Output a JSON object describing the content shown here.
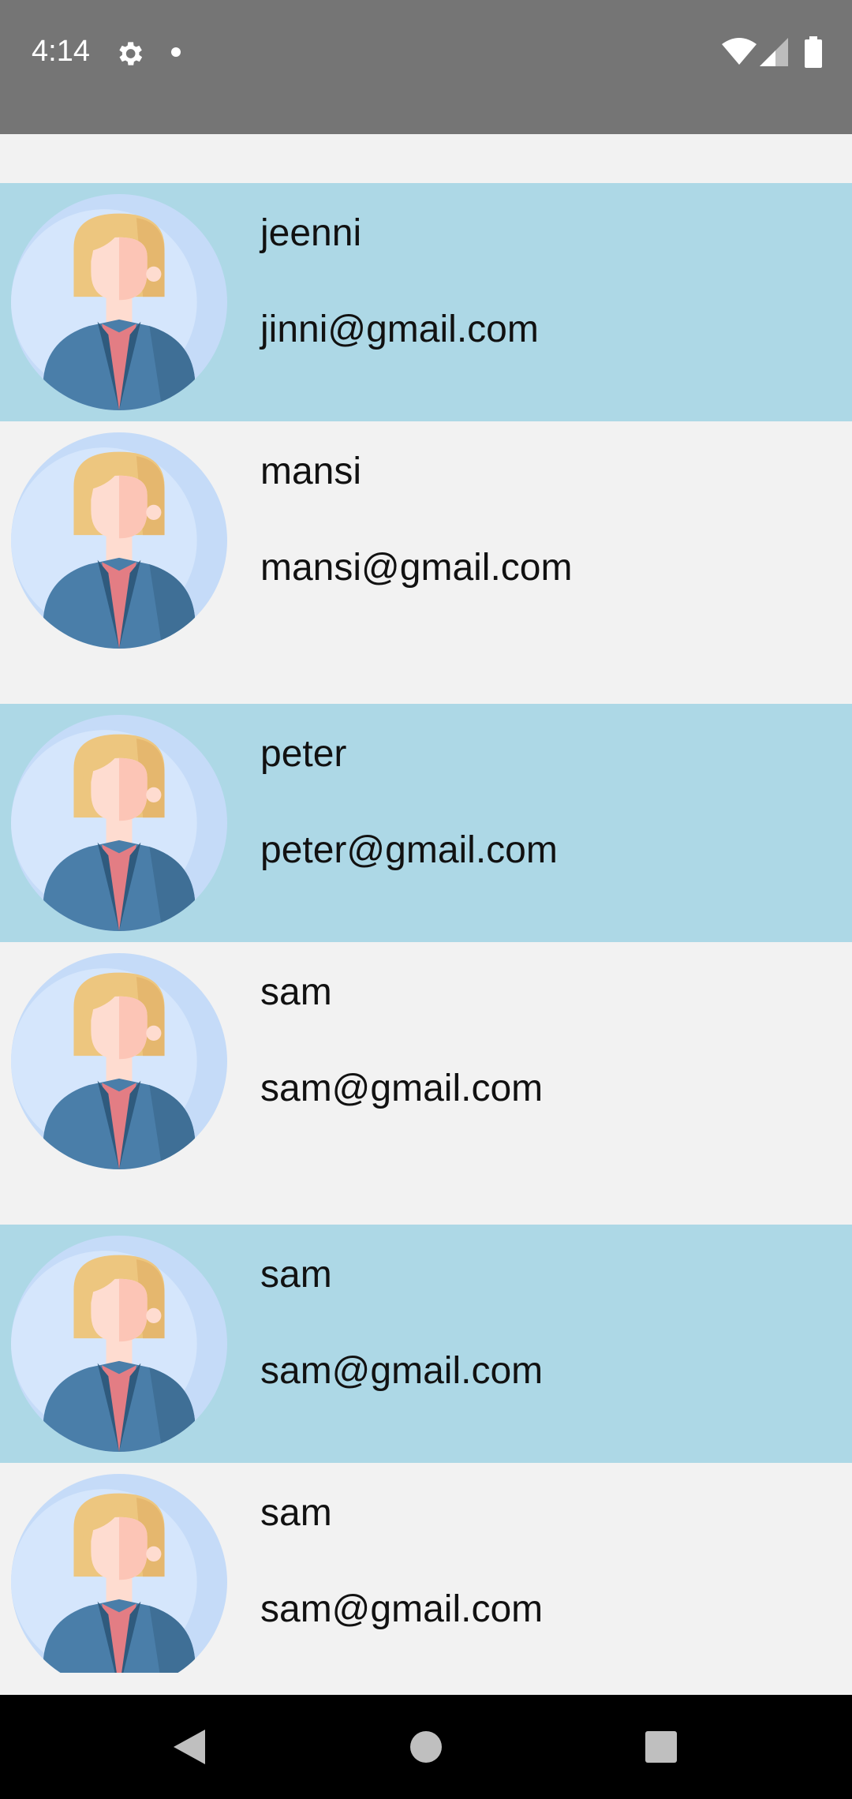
{
  "status_bar": {
    "time": "4:14",
    "icons": [
      "gear-icon",
      "dot-icon",
      "wifi-icon",
      "signal-icon",
      "battery-icon"
    ]
  },
  "colors": {
    "highlight_row": "#add8e6",
    "plain_row": "#f2f2f2",
    "status_bar": "#757575",
    "nav_bar": "#000000"
  },
  "contacts": [
    {
      "name": "jeenni",
      "email": "jinni@gmail.com",
      "highlighted": true
    },
    {
      "name": "mansi",
      "email": "mansi@gmail.com",
      "highlighted": false
    },
    {
      "name": "peter",
      "email": "peter@gmail.com",
      "highlighted": true
    },
    {
      "name": "sam",
      "email": "sam@gmail.com",
      "highlighted": false
    },
    {
      "name": "sam",
      "email": "sam@gmail.com",
      "highlighted": true
    },
    {
      "name": "sam",
      "email": "sam@gmail.com",
      "highlighted": false
    }
  ],
  "nav_bar": {
    "icons": [
      "back-icon",
      "home-icon",
      "recents-icon"
    ]
  }
}
